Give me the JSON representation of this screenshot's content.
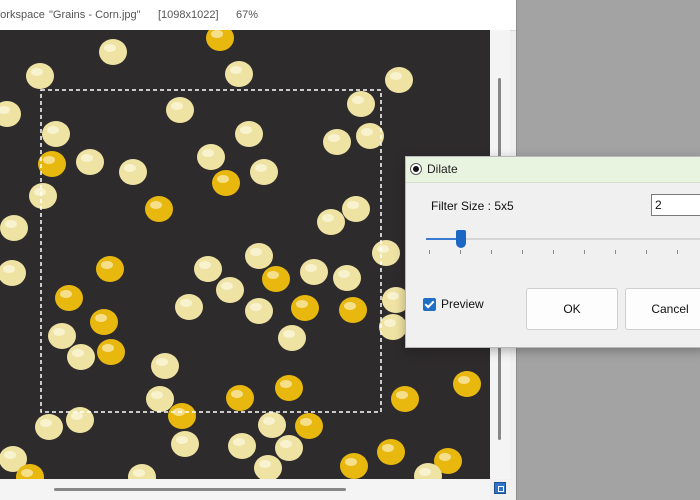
{
  "workspace": {
    "title": {
      "app": "Workspace",
      "file": "\"Grains - Corn.jpg\"",
      "size": "[1098x1022]",
      "zoom": "67%"
    }
  },
  "image": {
    "alt": "Corn kernels on a dark background",
    "background": "#2e2b2d",
    "kernel_color": "#efe3a4",
    "kernel_dark": "#e8b80f"
  },
  "dialog": {
    "title": "Dilate",
    "filter_size_label": "Filter Size : 5x5",
    "filter_size_value": "2",
    "slider_value": 2,
    "preview_label": "Preview",
    "preview_checked": true,
    "ok_label": "OK",
    "cancel_label": "Cancel",
    "accent": "#1d67c4"
  }
}
